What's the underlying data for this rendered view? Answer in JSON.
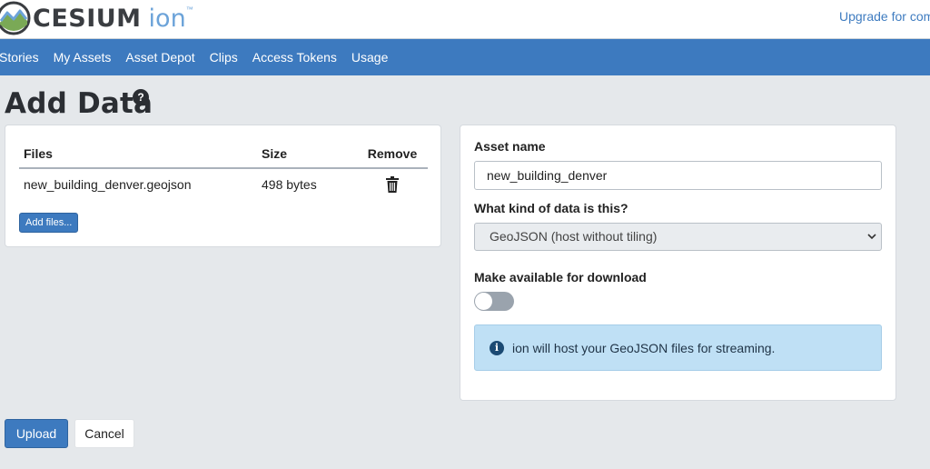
{
  "header": {
    "logo_text": "CESIUM",
    "logo_ion": "ion",
    "logo_tm": "™",
    "upgrade_link": "Upgrade for com"
  },
  "nav": {
    "items": [
      {
        "label": "Stories"
      },
      {
        "label": "My Assets"
      },
      {
        "label": "Asset Depot"
      },
      {
        "label": "Clips"
      },
      {
        "label": "Access Tokens"
      },
      {
        "label": "Usage"
      }
    ]
  },
  "page": {
    "title": "Add Data",
    "help_glyph": "?"
  },
  "files": {
    "headers": {
      "name": "Files",
      "size": "Size",
      "remove": "Remove"
    },
    "rows": [
      {
        "name": "new_building_denver.geojson",
        "size": "498 bytes",
        "remove_icon": "trash-icon"
      }
    ],
    "add_button": "Add files..."
  },
  "form": {
    "asset_name_label": "Asset name",
    "asset_name_value": "new_building_denver",
    "data_kind_label": "What kind of data is this?",
    "data_kind_value": "GeoJSON (host without tiling)",
    "download_label": "Make available for download",
    "download_enabled": false,
    "info_icon": "info-icon",
    "info_text": "ion will host your GeoJSON files for streaming."
  },
  "actions": {
    "upload": "Upload",
    "cancel": "Cancel"
  },
  "colors": {
    "accent": "#3d7abf",
    "background": "#e5e8eb",
    "info_bg": "#bfe0f5"
  }
}
